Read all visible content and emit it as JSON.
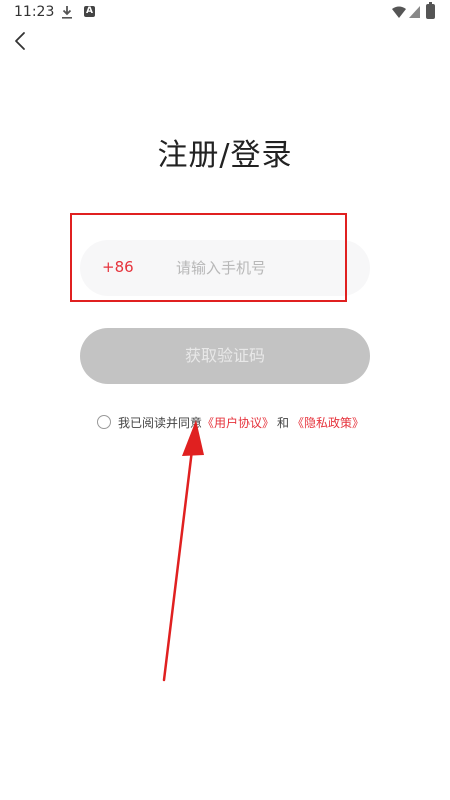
{
  "status_bar": {
    "time": "11:23"
  },
  "nav": {
    "back_icon": "chevron-left-icon"
  },
  "title": "注册/登录",
  "phone_field": {
    "country_code": "+86",
    "placeholder": "请输入手机号",
    "value": ""
  },
  "code_button": {
    "label": "获取验证码"
  },
  "agreement": {
    "prefix": "我已阅读并同意",
    "user_agreement": "《用户协议》",
    "conjunction": "和",
    "privacy_policy": "《隐私政策》"
  },
  "colors": {
    "accent": "#e6333c",
    "button_disabled": "#c3c3c3",
    "annotation": "#e02020"
  }
}
